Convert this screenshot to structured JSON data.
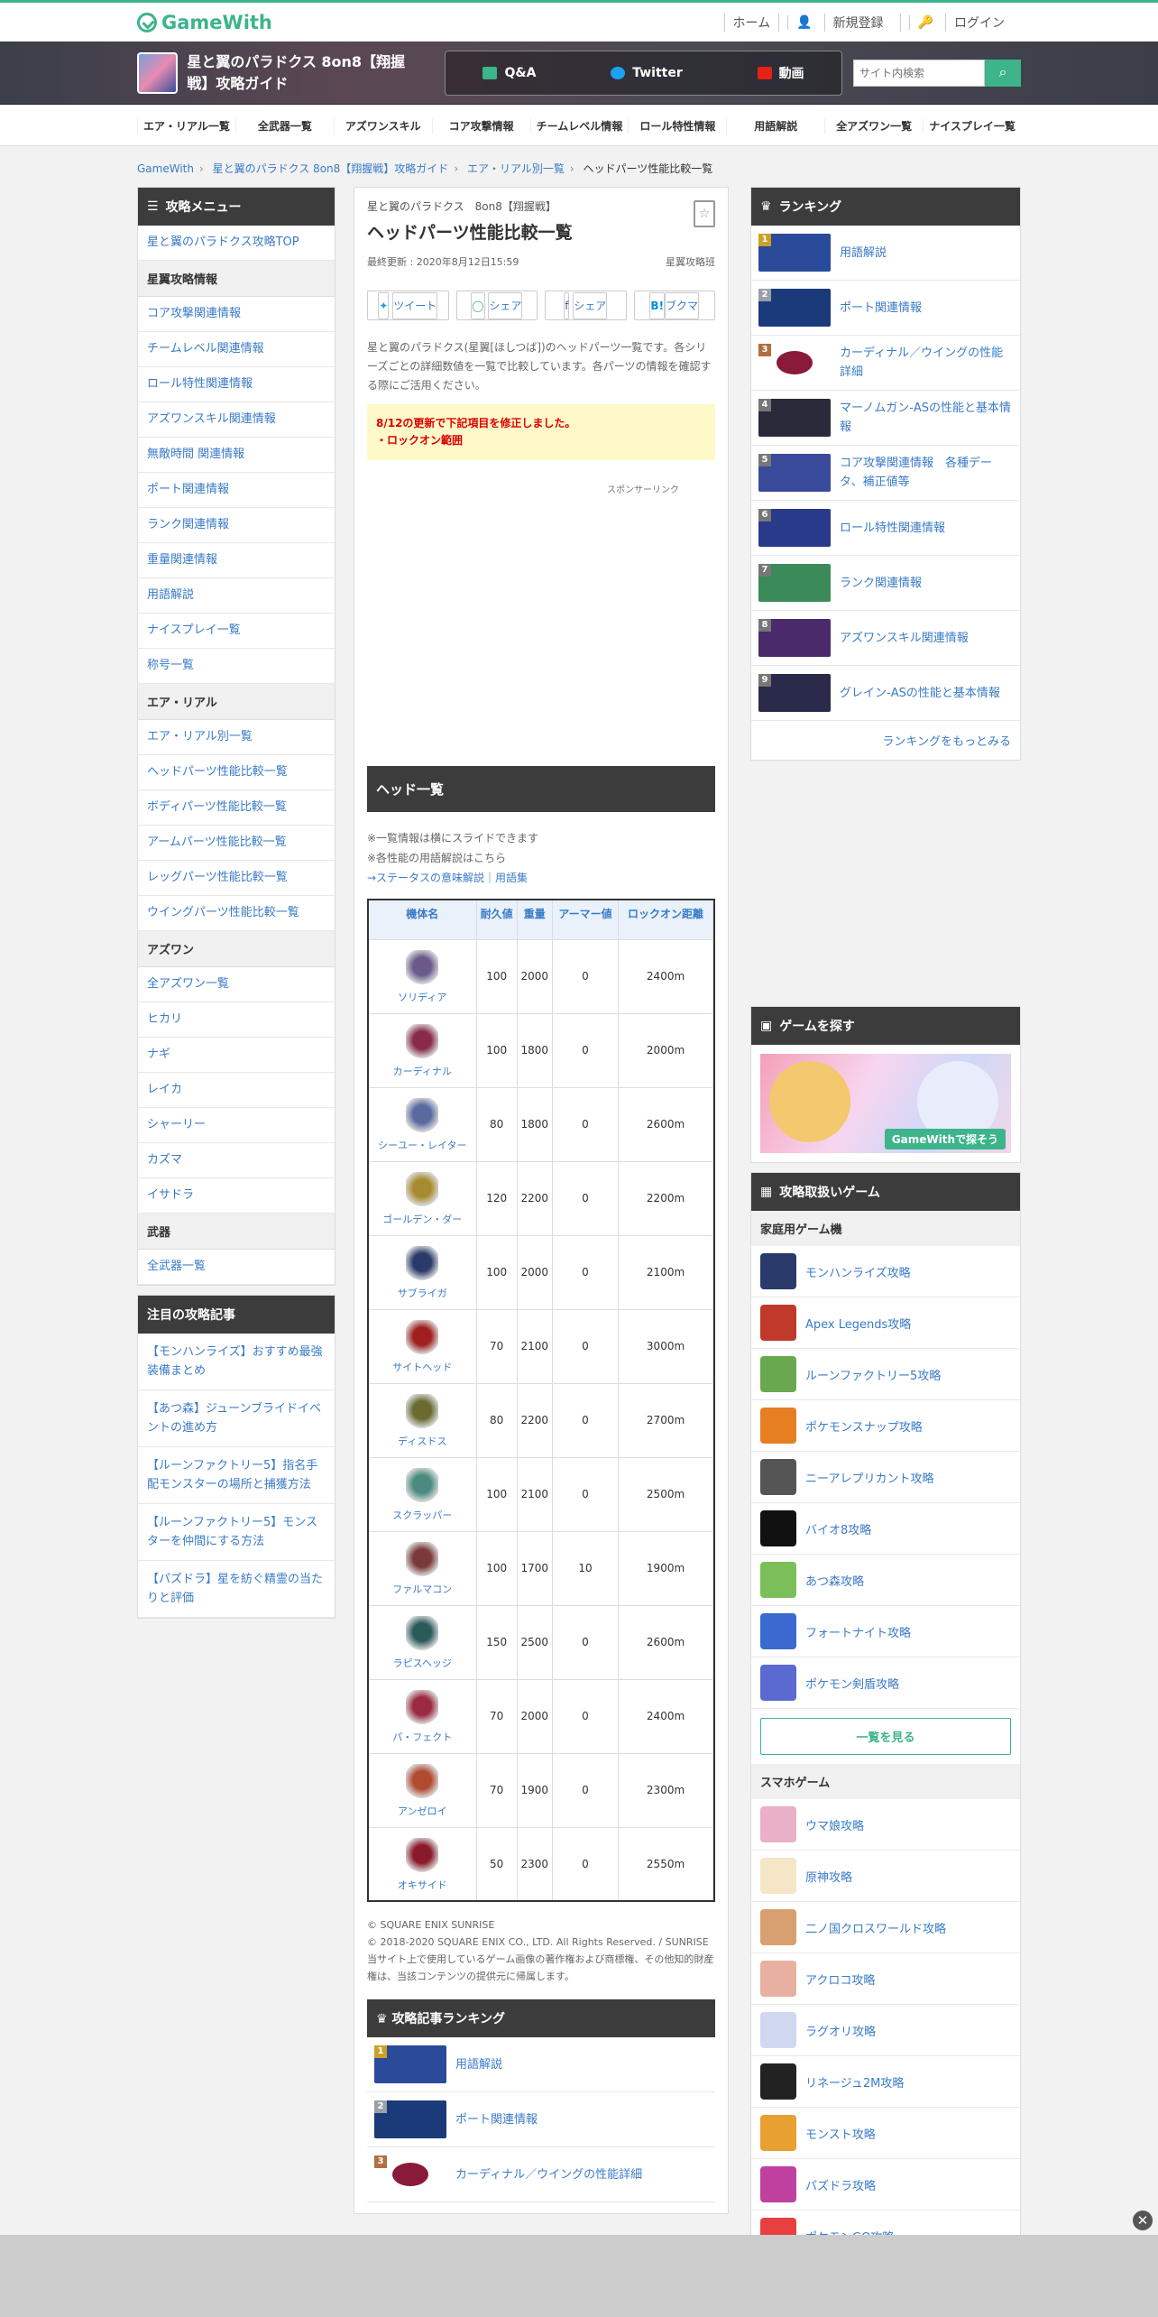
{
  "brand": "GameWith",
  "toplinks": [
    "ホーム",
    "新規登録",
    "ログイン"
  ],
  "game_title": "星と翼のパラドクス 8on8【翔握戦】攻略ガイド",
  "bandnav": [
    "Q&A",
    "Twitter",
    "動画"
  ],
  "search_placeholder": "サイト内検索",
  "catnav": [
    "エア・リアル一覧",
    "全武器一覧",
    "アズワンスキル",
    "コア攻撃情報",
    "チームレベル情報",
    "ロール特性情報",
    "用語解説",
    "全アズワン一覧",
    "ナイスプレイ一覧"
  ],
  "breadcrumb": [
    "GameWith",
    "星と翼のパラドクス 8on8【翔握戦】攻略ガイド",
    "エア・リアル別一覧",
    "ヘッドパーツ性能比較一覧"
  ],
  "leftmenu": {
    "title": "攻略メニュー",
    "top": "星と翼のパラドクス攻略TOP",
    "sections": [
      {
        "name": "星翼攻略情報",
        "items": [
          "コア攻撃関連情報",
          "チームレベル関連情報",
          "ロール特性関連情報",
          "アズワンスキル関連情報",
          "無敵時間 関連情報",
          "ポート関連情報",
          "ランク関連情報",
          "重量関連情報",
          "用語解説",
          "ナイスプレイ一覧",
          "称号一覧"
        ]
      },
      {
        "name": "エア・リアル",
        "items": [
          "エア・リアル別一覧",
          "ヘッドパーツ性能比較一覧",
          "ボディパーツ性能比較一覧",
          "アームパーツ性能比較一覧",
          "レッグパーツ性能比較一覧",
          "ウイングパーツ性能比較一覧"
        ]
      },
      {
        "name": "アズワン",
        "items": [
          "全アズワン一覧",
          "ヒカリ",
          "ナギ",
          "レイカ",
          "シャーリー",
          "カズマ",
          "イサドラ"
        ]
      },
      {
        "name": "武器",
        "items": [
          "全武器一覧"
        ]
      }
    ]
  },
  "featured": {
    "title": "注目の攻略記事",
    "items": [
      "【モンハンライズ】おすすめ最強装備まとめ",
      "【あつ森】ジューンブライドイベントの進め方",
      "【ルーンファクトリー5】指名手配モンスターの場所と捕獲方法",
      "【ルーンファクトリー5】モンスターを仲間にする方法",
      "【パズドラ】星を紡ぐ精霊の当たりと評価"
    ]
  },
  "article": {
    "kicker": "星と翼のパラドクス　8on8【翔握戦】",
    "title": "ヘッドパーツ性能比較一覧",
    "updated": "最終更新 : 2020年8月12日15:59",
    "author": "星翼攻略班",
    "share": [
      "ツイート",
      "シェア",
      "シェア",
      "ブクマ"
    ],
    "intro": "星と翼のパラドクス(星翼[ほしつば])のヘッドパーツ一覧です。各シリーズごとの詳細数値を一覧で比較しています。各パーツの情報を確認する際にご活用ください。",
    "notice1": "8/12の更新で下記項目を修正しました。",
    "notice2": "・ロックオン範囲",
    "sponsor": "スポンサーリンク",
    "section": "ヘッド一覧",
    "note1": "※一覧情報は横にスライドできます",
    "note2": "※各性能の用語解説はこちら",
    "note3": "→ステータスの意味解説｜用語集",
    "headers": [
      "機体名",
      "耐久値",
      "重量",
      "アーマー値",
      "ロックオン距離"
    ],
    "rows": [
      {
        "name": "ソリディア",
        "hp": "100",
        "w": "2000",
        "armor": "0",
        "lock": "2400m",
        "color": "#6a5a8a"
      },
      {
        "name": "カーディナル",
        "hp": "100",
        "w": "1800",
        "armor": "0",
        "lock": "2000m",
        "color": "#8a2a4a"
      },
      {
        "name": "シーユー・レイター",
        "hp": "80",
        "w": "1800",
        "armor": "0",
        "lock": "2600m",
        "color": "#5a6aa0"
      },
      {
        "name": "ゴールデン・ダー",
        "hp": "120",
        "w": "2200",
        "armor": "0",
        "lock": "2200m",
        "color": "#a88a30"
      },
      {
        "name": "サブライガ",
        "hp": "100",
        "w": "2000",
        "armor": "0",
        "lock": "2100m",
        "color": "#2a3a6a"
      },
      {
        "name": "サイトヘッド",
        "hp": "70",
        "w": "2100",
        "armor": "0",
        "lock": "3000m",
        "color": "#a02020"
      },
      {
        "name": "ディスドス",
        "hp": "80",
        "w": "2200",
        "armor": "0",
        "lock": "2700m",
        "color": "#6a6a30"
      },
      {
        "name": "スクラッパー",
        "hp": "100",
        "w": "2100",
        "armor": "0",
        "lock": "2500m",
        "color": "#4a8a80"
      },
      {
        "name": "ファルマコン",
        "hp": "100",
        "w": "1700",
        "armor": "10",
        "lock": "1900m",
        "color": "#7a3a3a"
      },
      {
        "name": "ラピスヘッジ",
        "hp": "150",
        "w": "2500",
        "armor": "0",
        "lock": "2600m",
        "color": "#2a5a5a"
      },
      {
        "name": "パ・フェクト",
        "hp": "70",
        "w": "2000",
        "armor": "0",
        "lock": "2400m",
        "color": "#9a2a40"
      },
      {
        "name": "アンゼロイ",
        "hp": "70",
        "w": "1900",
        "armor": "0",
        "lock": "2300m",
        "color": "#b04a30"
      },
      {
        "name": "オキサイド",
        "hp": "50",
        "w": "2300",
        "armor": "0",
        "lock": "2550m",
        "color": "#8a1a2a"
      }
    ],
    "copy1": "© SQUARE ENIX SUNRISE",
    "copy2": "© 2018-2020 SQUARE ENIX CO., LTD. All Rights Reserved. / SUNRISE",
    "copy3": "当サイト上で使用しているゲーム画像の著作権および商標権、その他知的財産権は、当該コンテンツの提供元に帰属します。",
    "rank_title": "攻略記事ランキング",
    "rank": [
      "用語解説",
      "ポート関連情報",
      "カーディナル／ウイングの性能詳細"
    ]
  },
  "ranking": {
    "title": "ランキング",
    "items": [
      "用語解説",
      "ポート関連情報",
      "カーディナル／ウイングの性能詳細",
      "マーノムガン-ASの性能と基本情報",
      "コア攻撃関連情報　各種データ、補正値等",
      "ロール特性関連情報",
      "ランク関連情報",
      "アズワンスキル関連情報",
      "グレイン-ASの性能と基本情報"
    ],
    "more": "ランキングをもっとみる"
  },
  "findgame": {
    "title": "ゲームを探す",
    "banner": "GameWithで探そう"
  },
  "games": {
    "title": "攻略取扱いゲーム",
    "console": "家庭用ゲーム機",
    "console_items": [
      "モンハンライズ攻略",
      "Apex Legends攻略",
      "ルーンファクトリー5攻略",
      "ポケモンスナップ攻略",
      "ニーアレプリカント攻略",
      "バイオ8攻略",
      "あつ森攻略",
      "フォートナイト攻略",
      "ポケモン剣盾攻略"
    ],
    "seeall": "一覧を見る",
    "mobile": "スマホゲーム",
    "mobile_items": [
      "ウマ娘攻略",
      "原神攻略",
      "二ノ国クロスワールド攻略",
      "アクロコ攻略",
      "ラグオリ攻略",
      "リネージュ2M攻略",
      "モンスト攻略",
      "パズドラ攻略",
      "ポケモンGO攻略"
    ]
  },
  "colors": {
    "accent": "#3db48a",
    "link": "#3a7bc8",
    "header": "#3c3c3c"
  }
}
